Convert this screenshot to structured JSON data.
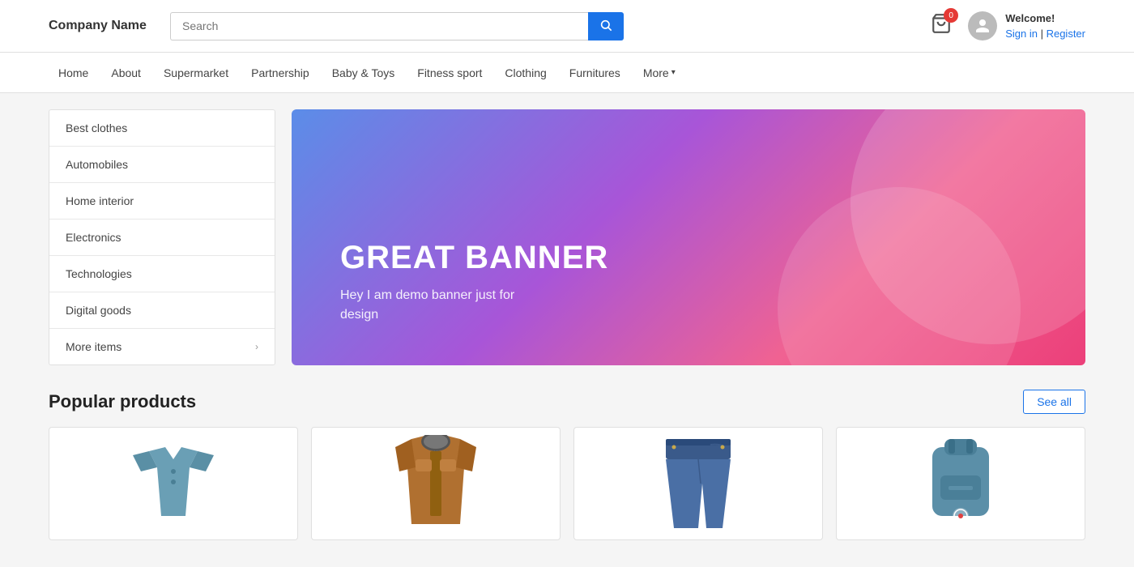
{
  "header": {
    "logo": "Company Name",
    "search_placeholder": "Search",
    "search_button_label": "🔍",
    "cart_count": "0",
    "welcome_text": "Welcome!",
    "sign_in_label": "Sign in",
    "register_label": "Register"
  },
  "nav": {
    "items": [
      {
        "label": "Home"
      },
      {
        "label": "About"
      },
      {
        "label": "Supermarket"
      },
      {
        "label": "Partnership"
      },
      {
        "label": "Baby &amp; Toys"
      },
      {
        "label": "Fitness sport"
      },
      {
        "label": "Clothing"
      },
      {
        "label": "Furnitures"
      },
      {
        "label": "More",
        "has_dropdown": true
      }
    ]
  },
  "sidebar": {
    "items": [
      {
        "label": "Best clothes",
        "has_arrow": false
      },
      {
        "label": "Automobiles",
        "has_arrow": false
      },
      {
        "label": "Home interior",
        "has_arrow": false
      },
      {
        "label": "Electronics",
        "has_arrow": false
      },
      {
        "label": "Technologies",
        "has_arrow": false
      },
      {
        "label": "Digital goods",
        "has_arrow": false
      },
      {
        "label": "More items",
        "has_arrow": true
      }
    ]
  },
  "banner": {
    "title": "GREAT BANNER",
    "subtitle": "Hey I am demo banner just for design"
  },
  "popular_section": {
    "title": "Popular products",
    "see_all_label": "See all",
    "products": [
      {
        "id": 1,
        "color": "#6a9fb5",
        "type": "shirt"
      },
      {
        "id": 2,
        "color": "#b87333",
        "type": "jacket"
      },
      {
        "id": 3,
        "color": "#4a6fa5",
        "type": "jeans"
      },
      {
        "id": 4,
        "color": "#5b8fa8",
        "type": "backpack"
      }
    ]
  }
}
